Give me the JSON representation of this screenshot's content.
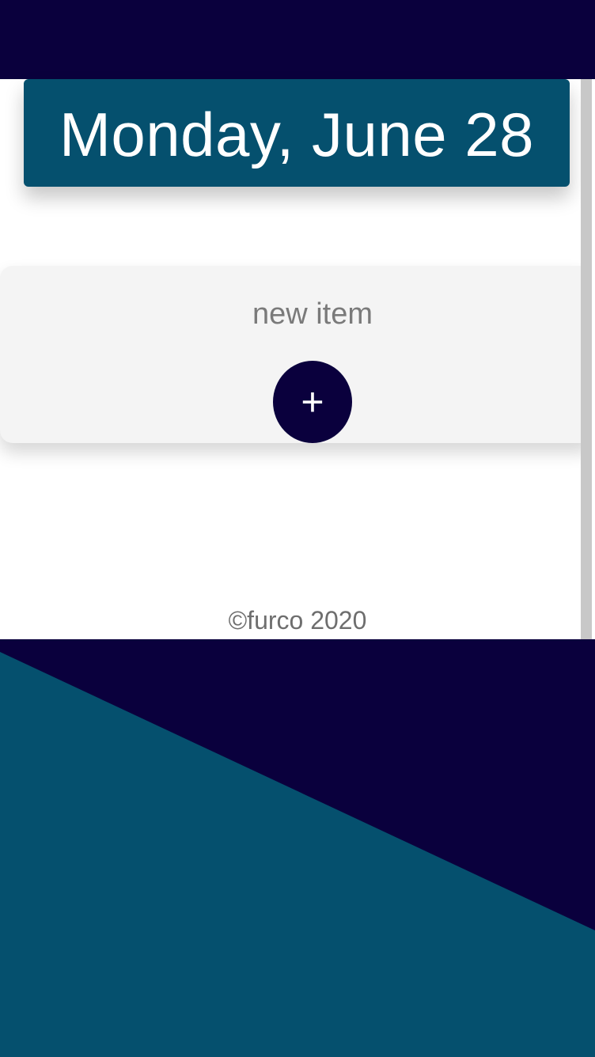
{
  "colors": {
    "navy": "#0a003d",
    "teal": "#05506e",
    "card": "#f4f4f4",
    "text_muted": "#7a7a7a",
    "white": "#ffffff"
  },
  "header": {
    "date": "Monday, June 28"
  },
  "new_item": {
    "label": "new item",
    "add_button": "+"
  },
  "footer": {
    "copyright": "©furco 2020"
  }
}
